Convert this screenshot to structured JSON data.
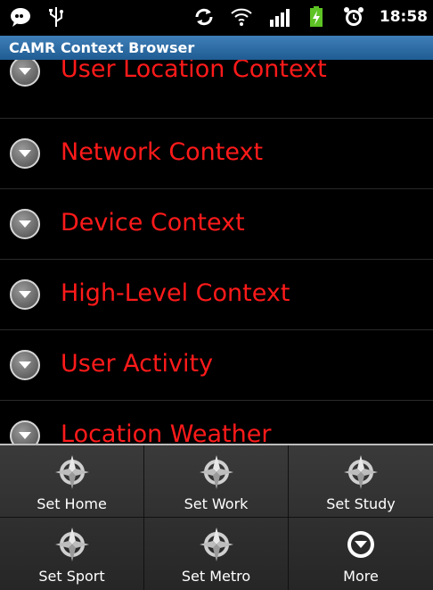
{
  "status_bar": {
    "time": "18:58",
    "icons": [
      "chat-icon",
      "usb-icon",
      "sync-icon",
      "wifi-icon",
      "signal-icon",
      "battery-charging-icon",
      "alarm-icon"
    ]
  },
  "app": {
    "title": "CAMR Context Browser"
  },
  "list": {
    "items": [
      {
        "label": "User Location Context"
      },
      {
        "label": "Network  Context"
      },
      {
        "label": "Device Context"
      },
      {
        "label": "High-Level Context"
      },
      {
        "label": "User Activity"
      },
      {
        "label": "Location Weather"
      }
    ],
    "label_color": "#ff1a1a"
  },
  "menu": {
    "items": [
      {
        "label": "Set Home",
        "icon": "compass-icon"
      },
      {
        "label": "Set Work",
        "icon": "compass-icon"
      },
      {
        "label": "Set Study",
        "icon": "compass-icon"
      },
      {
        "label": "Set Sport",
        "icon": "compass-icon"
      },
      {
        "label": "Set Metro",
        "icon": "compass-icon"
      },
      {
        "label": "More",
        "icon": "more-icon"
      }
    ]
  }
}
